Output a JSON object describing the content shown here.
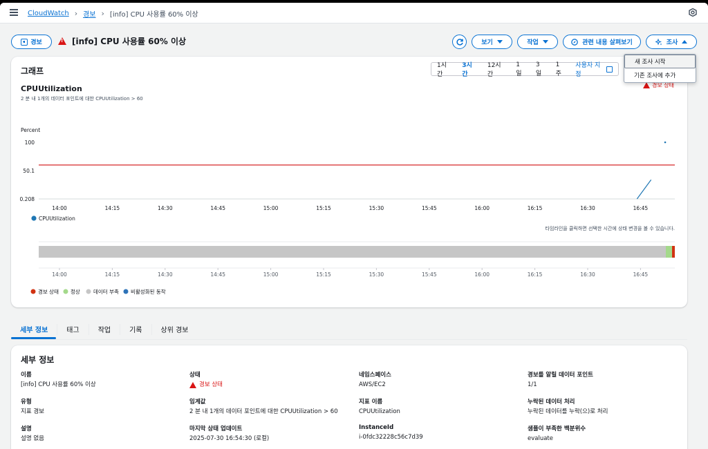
{
  "breadcrumb": {
    "root": "CloudWatch",
    "section": "경보",
    "current": "[info] CPU 사용률 60% 이상"
  },
  "header": {
    "alarm_button": "경보",
    "title": "[info] CPU 사용률 60% 이상",
    "view_label": "보기",
    "actions_label": "작업",
    "explore_related_label": "관련 내용 살펴보기",
    "investigate_label": "조사"
  },
  "investigate_menu": {
    "items": [
      "새 조사 시작",
      "기존 조사에 추가"
    ]
  },
  "graph": {
    "title": "그래프",
    "ranges": [
      "1시간",
      "3시간",
      "12시간",
      "1일",
      "3일",
      "1주"
    ],
    "active_range": "3시간",
    "custom_range": "사용자 지정",
    "metric_name": "CPUUtilization",
    "metric_desc": "2 분 내 1개의 데이터 포인트에 대한 CPUUtilization > 60",
    "alarm_state": "경보 상태",
    "timeline_hint": "타임라인을 클릭하면 선택한 시간에 상태 변경을 볼 수 있습니다."
  },
  "chart_data": {
    "type": "line",
    "ylabel": "Percent",
    "y_ticks": [
      "100",
      "50.1",
      "0.208"
    ],
    "ylim": [
      0.208,
      100
    ],
    "x_ticks": [
      "14:00",
      "14:15",
      "14:30",
      "14:45",
      "15:00",
      "15:15",
      "15:30",
      "15:45",
      "16:00",
      "16:15",
      "16:30",
      "16:45"
    ],
    "threshold": 60,
    "series": [
      {
        "name": "CPUUtilization",
        "points": [
          {
            "x": "16:44",
            "y": 0.208
          },
          {
            "x": "16:48",
            "y": 34
          }
        ]
      }
    ],
    "outlier_point": {
      "x": "16:52",
      "y": 100
    },
    "legend": [
      "CPUUtilization"
    ],
    "timeline_legend": [
      "경보 상태",
      "정상",
      "데이터 부족",
      "비활성화된 동작"
    ],
    "colors": {
      "series": "#1f77b4",
      "threshold": "#d62728",
      "alarm": "#d13212",
      "ok": "#a4d98b",
      "insufficient": "#c6c6c6",
      "disabled": "#2e73b8"
    }
  },
  "tabs": [
    "세부 정보",
    "태그",
    "작업",
    "기록",
    "상위 경보"
  ],
  "active_tab": "세부 정보",
  "details": {
    "title": "세부 정보",
    "col1": [
      {
        "label": "이름",
        "value": "[info] CPU 사용률 60% 이상"
      },
      {
        "label": "유형",
        "value": "지표 경보"
      },
      {
        "label": "설명",
        "value": "설명 없음"
      }
    ],
    "col2": [
      {
        "label": "상태",
        "value": "경보 상태"
      },
      {
        "label": "임계값",
        "value": "2 분 내 1개의 데이터 포인트에 대한 CPUUtilization > 60"
      },
      {
        "label": "마지막 상태 업데이트",
        "value": "2025-07-30 16:54:30 (로컬)"
      }
    ],
    "col3": [
      {
        "label": "네임스페이스",
        "value": "AWS/EC2"
      },
      {
        "label": "지표 이름",
        "value": "CPUUtilization"
      },
      {
        "label": "InstanceId",
        "value": "i-0fdc32228c56c7d39"
      }
    ],
    "col4": [
      {
        "label": "경보를 알릴 데이터 포인트",
        "value": "1/1"
      },
      {
        "label": "누락된 데이터 처리",
        "value": "누락된 데이터를 누락(으)로 처리"
      },
      {
        "label": "샘플이 부족한 백분위수",
        "value": "evaluate"
      }
    ]
  }
}
